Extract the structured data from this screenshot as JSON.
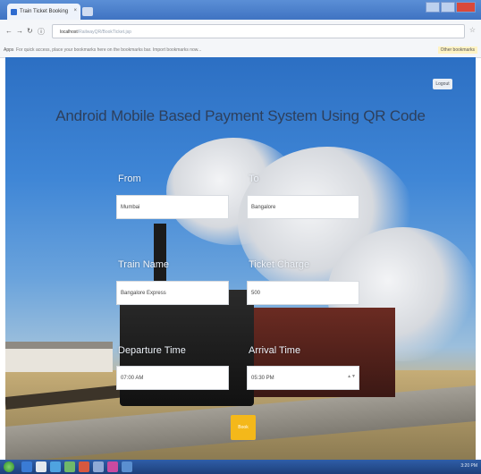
{
  "browser": {
    "tab_title": "Train Ticket Booking",
    "tab_close": "×",
    "url_host": "localhost",
    "url_path": "/RailwayQR/BookTicket.jsp",
    "bookmark_apps": "Apps",
    "bookmark_hint": "For quick access, place your bookmarks here on the bookmarks bar. Import bookmarks now...",
    "bookmark_other": "Other bookmarks"
  },
  "page": {
    "logout_label": "Logout",
    "title": "Android Mobile Based Payment System Using QR Code",
    "form": {
      "from_label": "From",
      "from_value": "Mumbai",
      "to_label": "To",
      "to_value": "Bangalore",
      "train_name_label": "Train Name",
      "train_name_value": "Bangalore Express",
      "ticket_charge_label": "Ticket Charge",
      "ticket_charge_value": "500",
      "departure_time_label": "Departure Time",
      "departure_time_value": "07:00 AM",
      "arrival_time_label": "Arrival Time",
      "arrival_time_value": "05:30 PM",
      "submit_label": "Book"
    }
  },
  "taskbar": {
    "tray_time": "3:20 PM"
  }
}
